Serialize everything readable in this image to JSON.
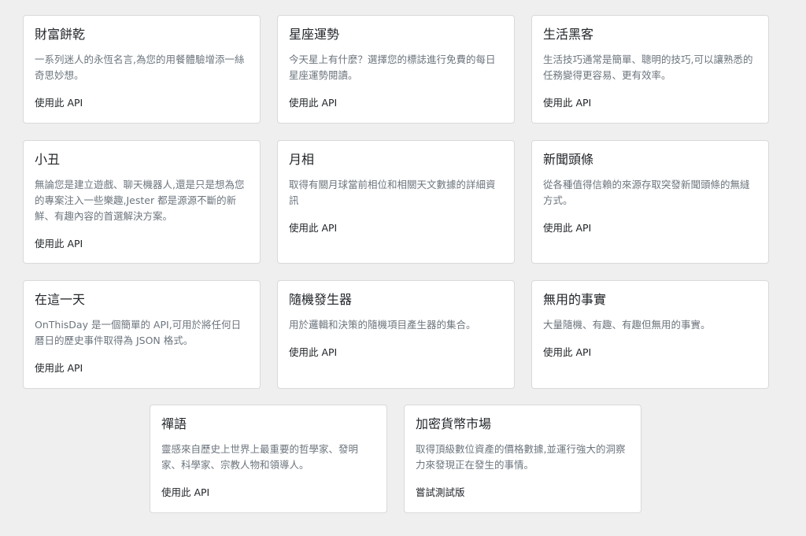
{
  "cards": [
    {
      "title": "財富餅乾",
      "description": "一系列迷人的永恆名言,為您的用餐體驗增添一絲奇思妙想。",
      "link": "使用此 API"
    },
    {
      "title": "星座運勢",
      "description": "今天星上有什麼？選擇您的標誌進行免費的每日星座運勢閱讀。",
      "link": "使用此 API"
    },
    {
      "title": "生活黑客",
      "description": "生活技巧通常是簡單、聰明的技巧,可以讓熟悉的任務變得更容易、更有效率。",
      "link": "使用此 API"
    },
    {
      "title": "小丑",
      "description": "無論您是建立遊戲、聊天機器人,還是只是想為您的專案注入一些樂趣,Jester 都是源源不斷的新鮮、有趣內容的首選解決方案。",
      "link": "使用此 API"
    },
    {
      "title": "月相",
      "description": "取得有關月球當前相位和相關天文數據的詳細資訊",
      "link": "使用此 API"
    },
    {
      "title": "新聞頭條",
      "description": "從各種值得信賴的來源存取突發新聞頭條的無縫方式。",
      "link": "使用此 API"
    },
    {
      "title": "在這一天",
      "description": "OnThisDay 是一個簡單的 API,可用於將任何日曆日的歷史事件取得為 JSON 格式。",
      "link": "使用此 API"
    },
    {
      "title": "隨機發生器",
      "description": "用於邏輯和決策的隨機項目產生器的集合。",
      "link": "使用此 API"
    },
    {
      "title": "無用的事實",
      "description": "大量隨機、有趣、有趣但無用的事實。",
      "link": "使用此 API"
    },
    {
      "title": "禪語",
      "description": "靈感來自歷史上世界上最重要的哲學家、發明家、科學家、宗教人物和領導人。",
      "link": "使用此 API"
    },
    {
      "title": "加密貨幣市場",
      "description": "取得頂級數位資產的價格數據,並運行強大的洞察力來發現正在發生的事情。",
      "link": "嘗試測試版"
    }
  ]
}
